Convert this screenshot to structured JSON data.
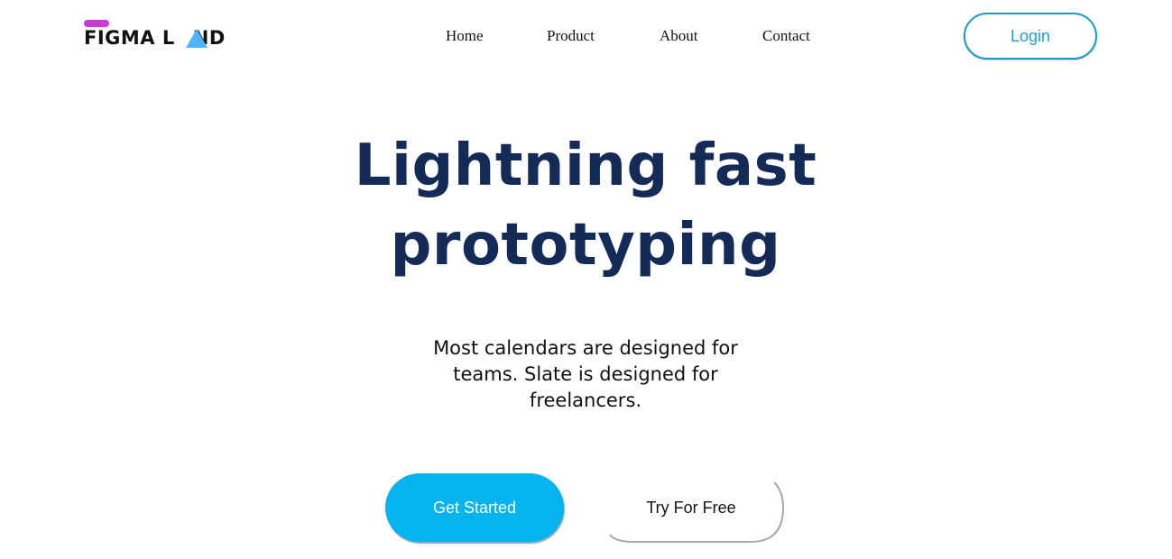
{
  "brand": {
    "name": "FIGMA LAND",
    "name_left": "FIGMA L",
    "name_right": "ND",
    "pill_color": "#c93ad6",
    "triangle_color": "#4fb3ff"
  },
  "nav": {
    "items": [
      {
        "label": "Home"
      },
      {
        "label": "Product"
      },
      {
        "label": "About"
      },
      {
        "label": "Contact"
      }
    ]
  },
  "header": {
    "login_label": "Login"
  },
  "hero": {
    "title_line1": "Lightning fast",
    "title_line2": "prototyping",
    "subtitle": "Most calendars are designed for teams. Slate is designed for freelancers."
  },
  "cta": {
    "primary_label": "Get Started",
    "secondary_label": "Try For Free"
  },
  "colors": {
    "title": "#142a57",
    "primary_button": "#05b3ee",
    "login_border": "#1a9bc5",
    "login_text": "#1aa3d8"
  }
}
